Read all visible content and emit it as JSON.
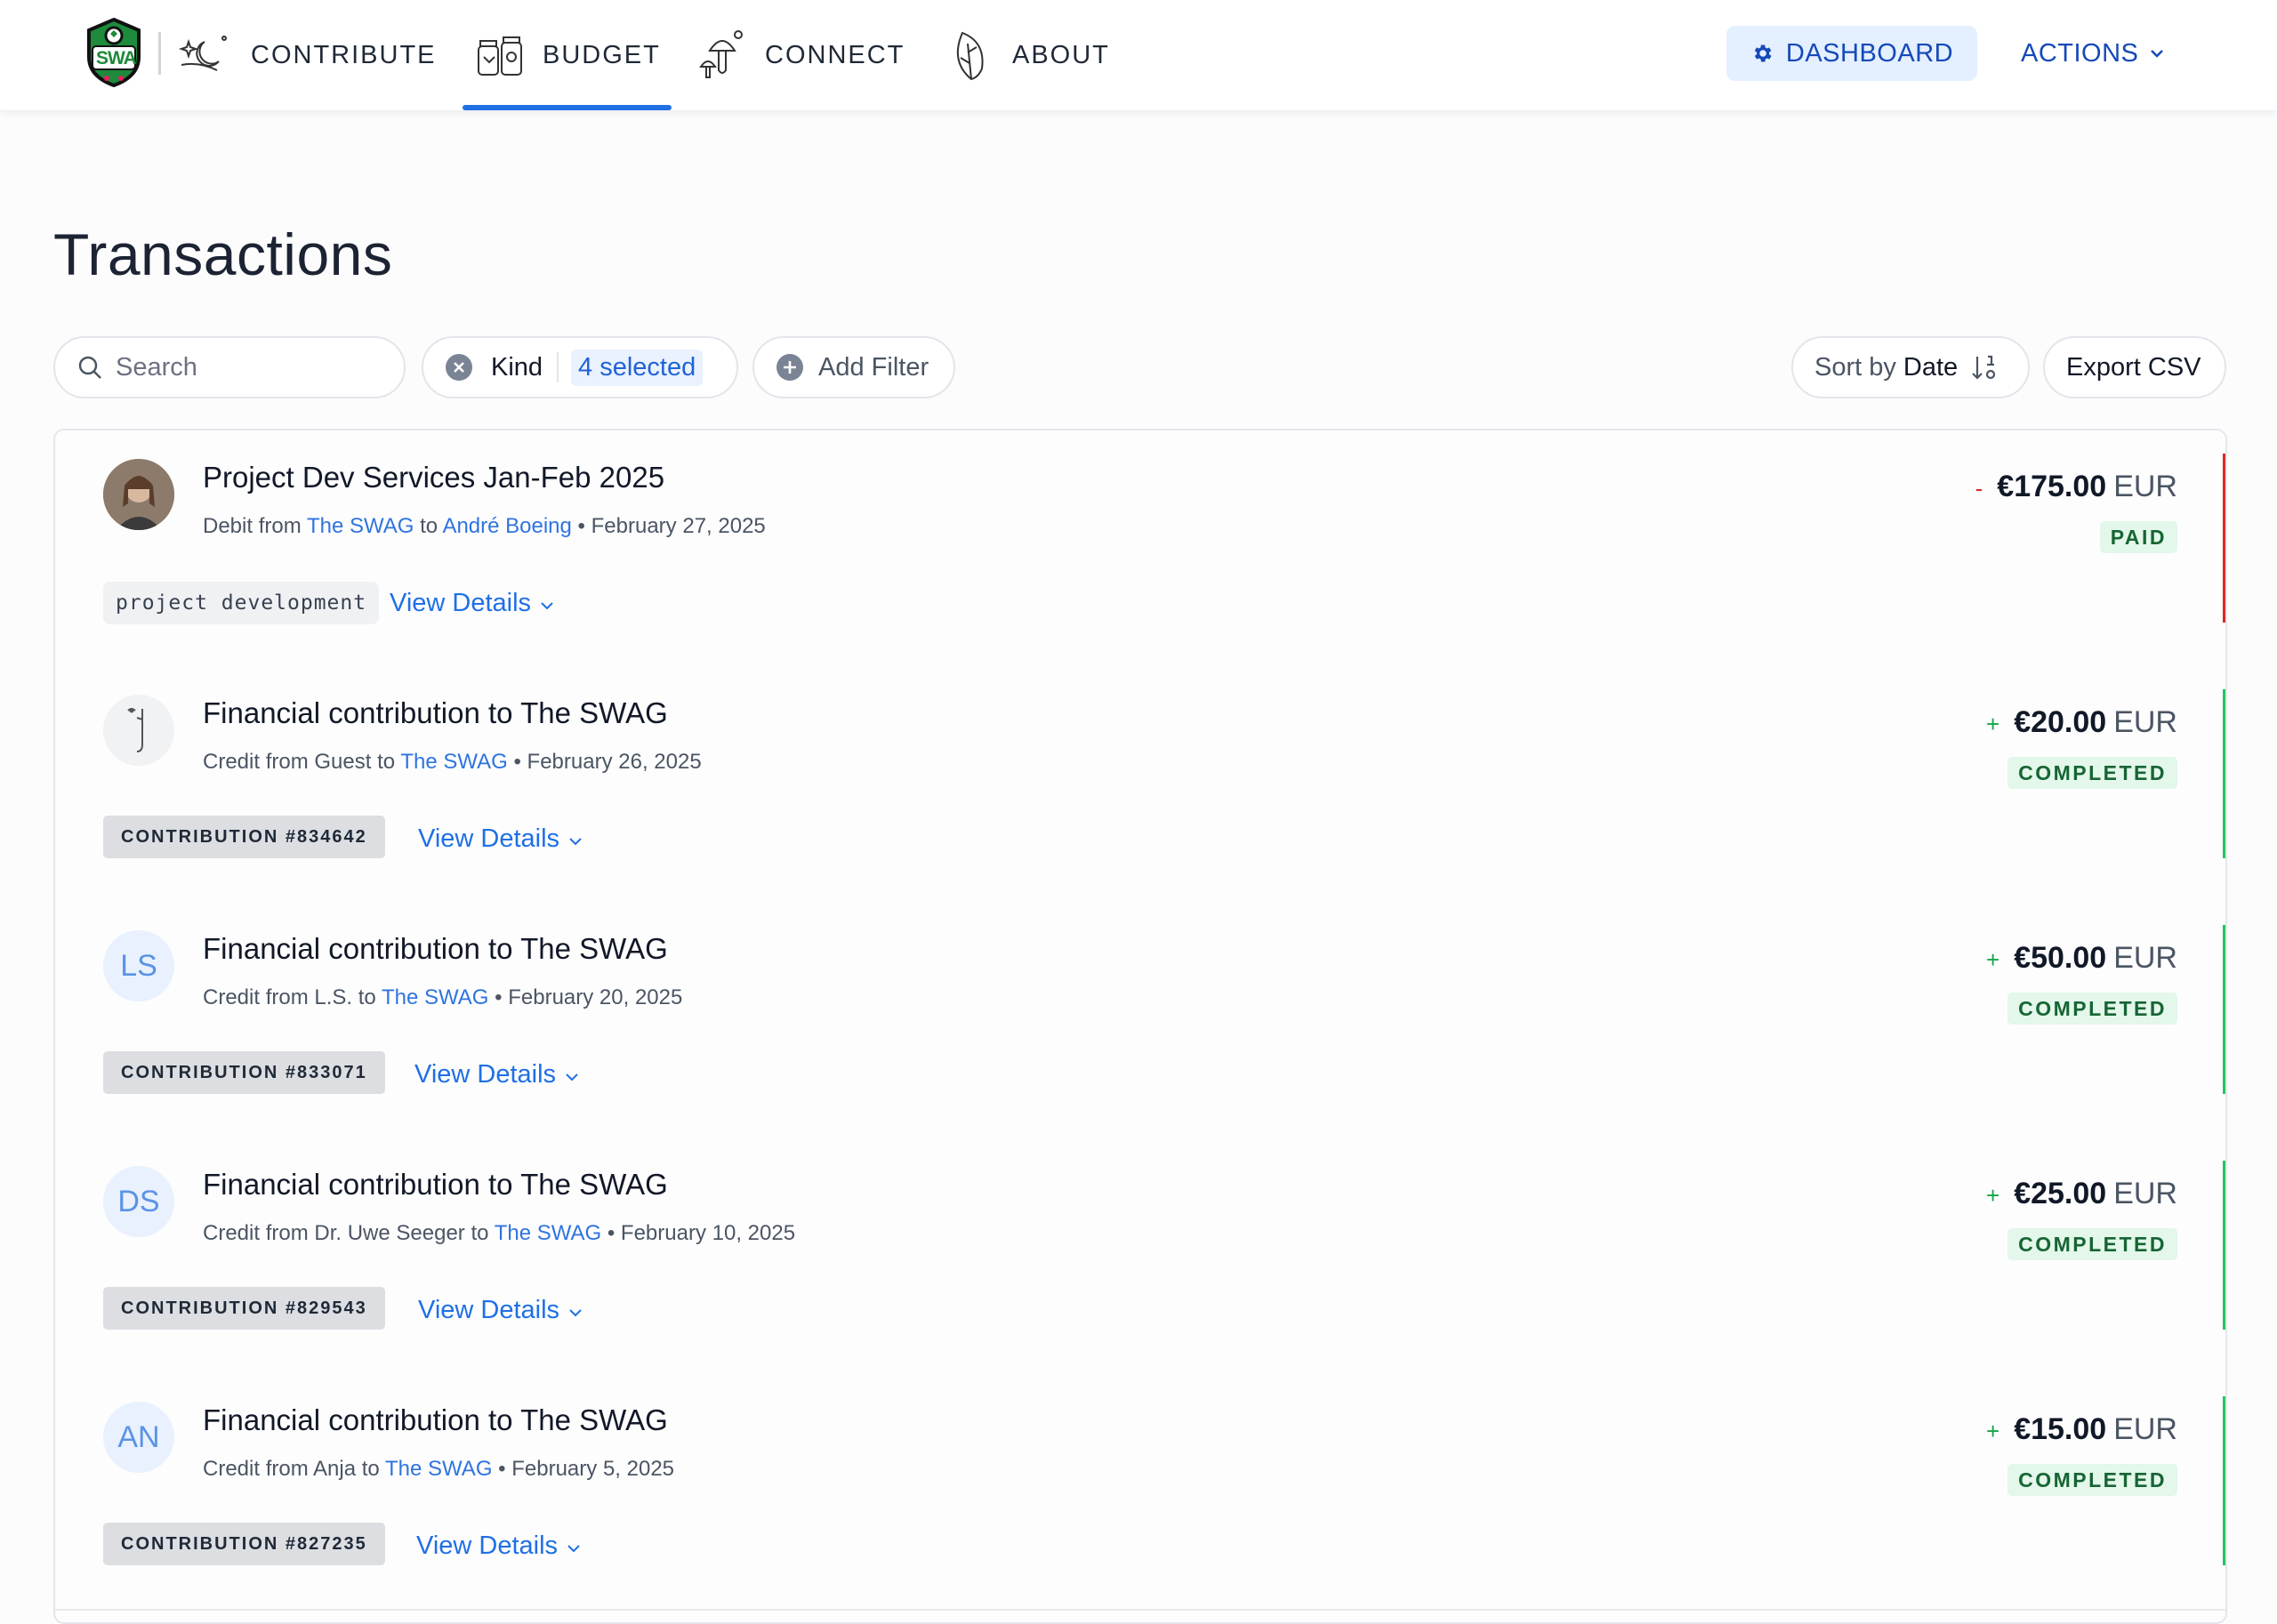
{
  "nav": {
    "items": [
      {
        "label": "CONTRIBUTE",
        "icon": "moon-stars-icon"
      },
      {
        "label": "BUDGET",
        "icon": "jars-icon",
        "active": true
      },
      {
        "label": "CONNECT",
        "icon": "mushrooms-icon"
      },
      {
        "label": "ABOUT",
        "icon": "leaf-icon"
      }
    ],
    "dashboard_label": "DASHBOARD",
    "actions_label": "ACTIONS",
    "logo_text": "SWA"
  },
  "page": {
    "title": "Transactions"
  },
  "filters": {
    "search_placeholder": "Search",
    "kind_label": "Kind",
    "kind_selected": "4 selected",
    "add_filter_label": "Add Filter",
    "sort_prefix": "Sort by",
    "sort_field": "Date",
    "export_label": "Export CSV"
  },
  "colors": {
    "accent": "#1f6fe5",
    "debit_edge": "#dc2626",
    "credit_edge": "#22c55e",
    "status_bg": "#e3f7ea",
    "status_text": "#166534"
  },
  "transactions": [
    {
      "title": "Project Dev Services Jan-Feb 2025",
      "type": "Debit",
      "from": "The SWAG",
      "to": "André Boeing",
      "date": "February 27, 2025",
      "sign": "-",
      "amount": "€175.00",
      "currency": "EUR",
      "status": "PAID",
      "tag": "project development",
      "avatar": "photo",
      "details_label": "View Details"
    },
    {
      "title": "Financial contribution to The SWAG",
      "type": "Credit",
      "from": "Guest",
      "to": "The SWAG",
      "date": "February 26, 2025",
      "sign": "+",
      "amount": "€20.00",
      "currency": "EUR",
      "status": "COMPLETED",
      "tag": "CONTRIBUTION #834642",
      "avatar": "guest",
      "details_label": "View Details"
    },
    {
      "title": "Financial contribution to The SWAG",
      "type": "Credit",
      "from": "L.S.",
      "to": "The SWAG",
      "date": "February 20, 2025",
      "sign": "+",
      "amount": "€50.00",
      "currency": "EUR",
      "status": "COMPLETED",
      "tag": "CONTRIBUTION #833071",
      "avatar": "LS",
      "details_label": "View Details"
    },
    {
      "title": "Financial contribution to The SWAG",
      "type": "Credit",
      "from": "Dr. Uwe Seeger",
      "to": "The SWAG",
      "date": "February 10, 2025",
      "sign": "+",
      "amount": "€25.00",
      "currency": "EUR",
      "status": "COMPLETED",
      "tag": "CONTRIBUTION #829543",
      "avatar": "DS",
      "details_label": "View Details"
    },
    {
      "title": "Financial contribution to The SWAG",
      "type": "Credit",
      "from": "Anja",
      "to": "The SWAG",
      "date": "February 5, 2025",
      "sign": "+",
      "amount": "€15.00",
      "currency": "EUR",
      "status": "COMPLETED",
      "tag": "CONTRIBUTION #827235",
      "avatar": "AN",
      "details_label": "View Details"
    }
  ]
}
